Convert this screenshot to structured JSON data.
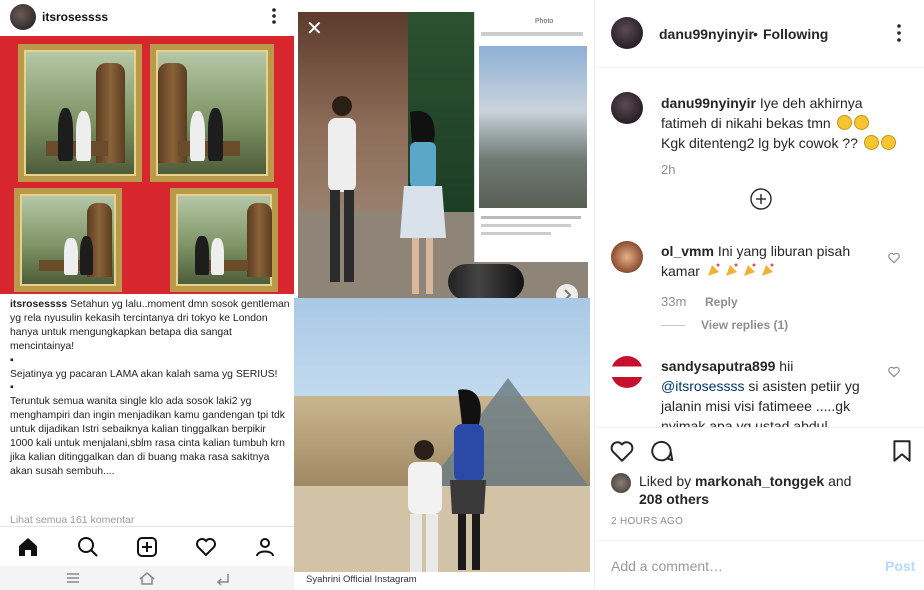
{
  "media": {
    "phone_username": "itsrosessss",
    "caption_user": "itsrosessss",
    "caption_lines": [
      "Setahun yg lalu..moment dmn sosok gentleman yg rela nyusulin kekasih tercintanya dri tokyo ke London hanya untuk mengungkapkan betapa dia sangat mencintainya!",
      "▪",
      "Sejatinya yg pacaran LAMA akan kalah sama yg SERIUS!",
      "▪",
      "Teruntuk semua wanita single klo ada sosok laki2 yg menghampiri dan ingin menjadikan kamu gandengan tpi tdk untuk dijadikan Istri sebaiknya kalian tinggalkan berpikir 1000 kali untuk menjalani,sblm rasa cinta kalian tumbuh krn jika kalian ditinggalkan dan di buang maka rasa sakitnya akan susah sembuh...."
    ],
    "view_all": "Lihat semua 161 komentar",
    "credit": "Syahrini Official Instagram",
    "inner_top_label": "Photo"
  },
  "post": {
    "author": "danu99nyinyir",
    "separator": "•",
    "follow_status": "Following",
    "main_comment": {
      "user": "danu99nyinyir",
      "text_line1": "Iye deh akhirnya fatimeh di nikahi bekas tmn",
      "text_line2": "Kgk ditenteng2 lg byk cowok ??",
      "time": "2h"
    },
    "comments": [
      {
        "user": "ol_vmm",
        "text": "Ini yang liburan pisah kamar",
        "time": "33m",
        "reply": "Reply",
        "view_replies": "View replies (1)"
      },
      {
        "user": "sandysaputra899",
        "text_pre": "hii",
        "mention": "@itsrosessss",
        "text_post": "si asisten petiir yg jalanin misi visi fatimeee .....gk nyimak apa yg ustad abdul"
      }
    ],
    "liked_by_prefix": "Liked by",
    "liked_by_user": "markonah_tonggek",
    "liked_by_and": "and",
    "liked_by_others": "208 others",
    "time_ago": "2 HOURS AGO",
    "comment_placeholder": "Add a comment…",
    "post_button": "Post"
  },
  "colors": {
    "mention": "#003569",
    "post_button_disabled": "#b3dbff",
    "muted": "#8e8e8e"
  }
}
